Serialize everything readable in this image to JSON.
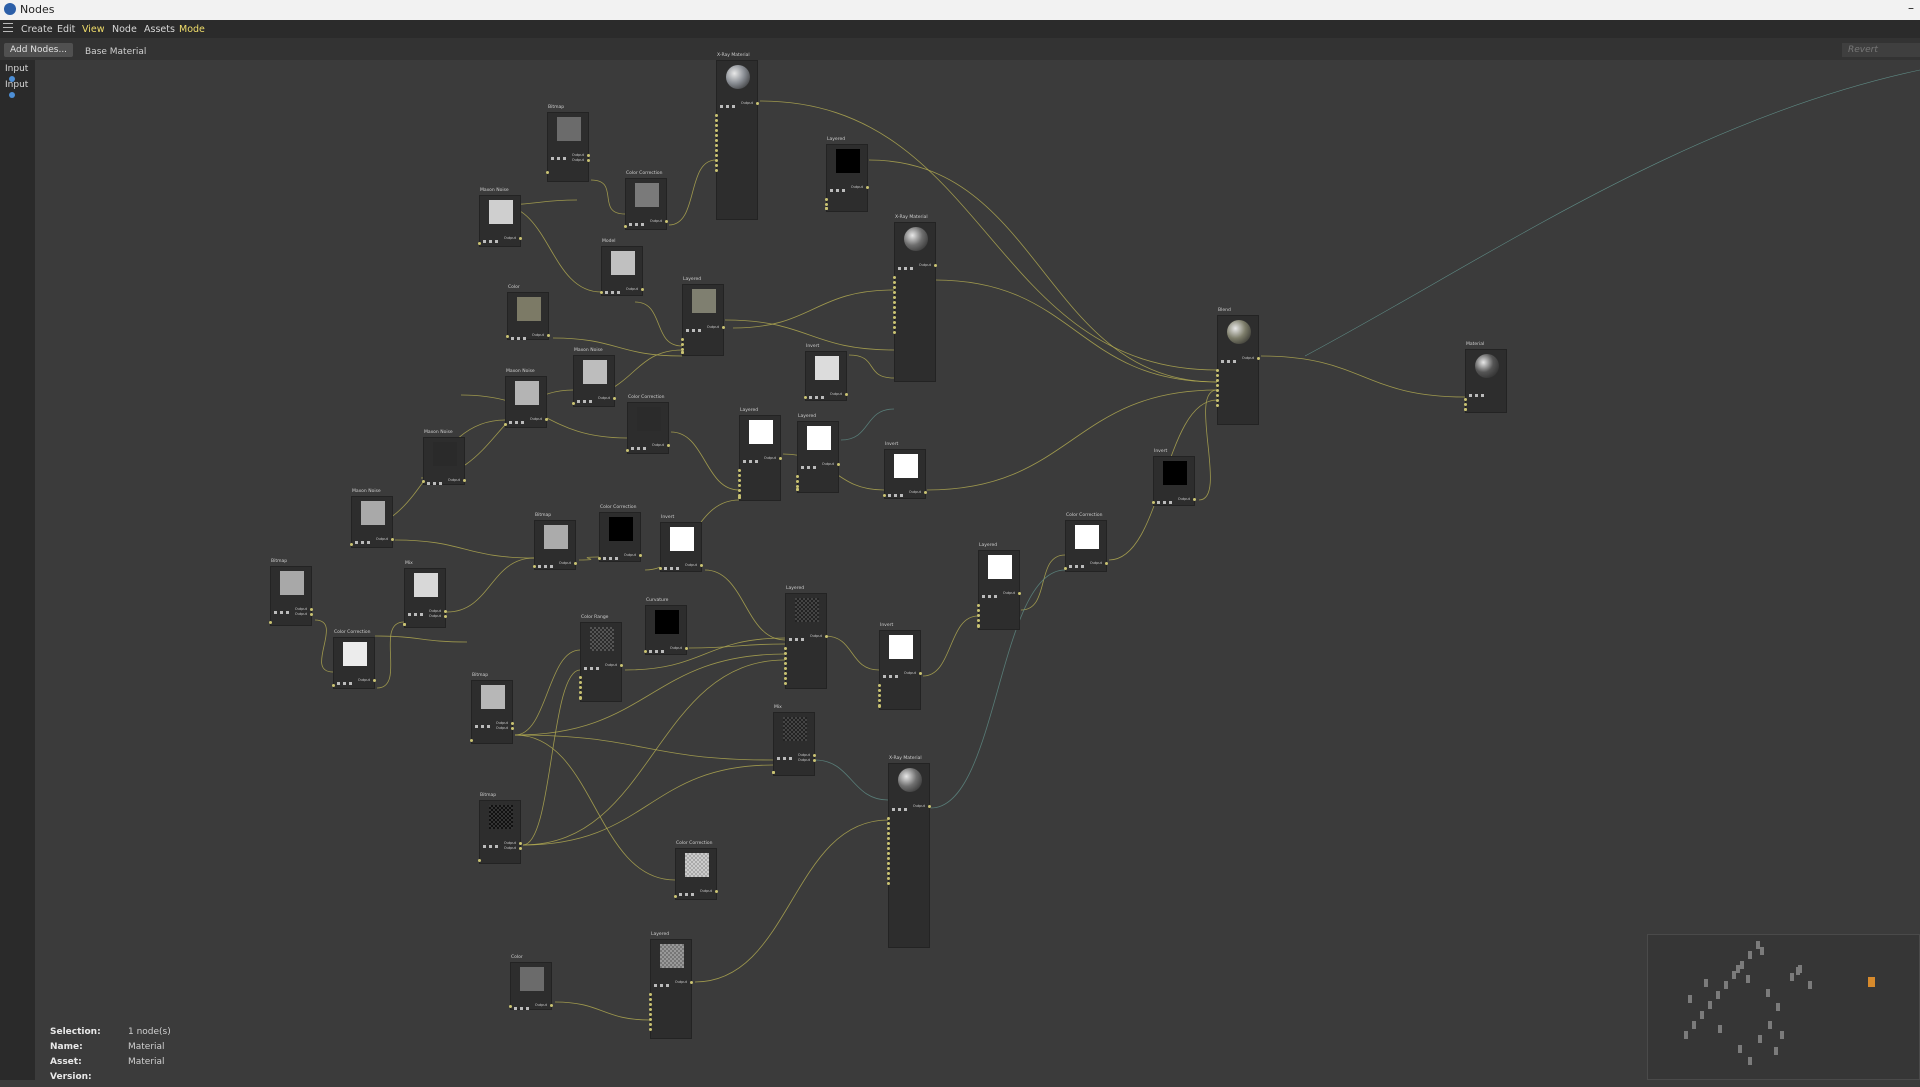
{
  "window": {
    "title": "Nodes"
  },
  "menu": {
    "items": [
      "Create",
      "Edit",
      "View",
      "Node",
      "Assets",
      "Mode"
    ]
  },
  "toolbar": {
    "add_nodes": "Add Nodes...",
    "breadcrumb": "Base Material",
    "revert": "Revert"
  },
  "input_ports": [
    "Input",
    "Input"
  ],
  "info_panel": {
    "selection_label": "Selection:",
    "selection_value": "1 node(s)",
    "name_label": "Name:",
    "name_value": "Material",
    "asset_label": "Asset:",
    "asset_value": "Material",
    "version_label": "Version:"
  },
  "node_labels": {
    "xray": "X-Ray Material",
    "bitmap": "Bitmap",
    "colorcorr": "Color Correction",
    "maxon": "Maxon Noise",
    "layered": "Layered",
    "color": "Color",
    "invert": "Invert",
    "model": "Model",
    "mix": "Mix",
    "colorrange": "Color Range",
    "curvature": "Curvature",
    "blend": "Blend",
    "material": "Material",
    "output": "Output"
  },
  "colors": {
    "wire": "#b8b052",
    "wire_teal": "#5f8c86",
    "port_in": "#4d8fd6",
    "accent": "#f0dd6a"
  }
}
